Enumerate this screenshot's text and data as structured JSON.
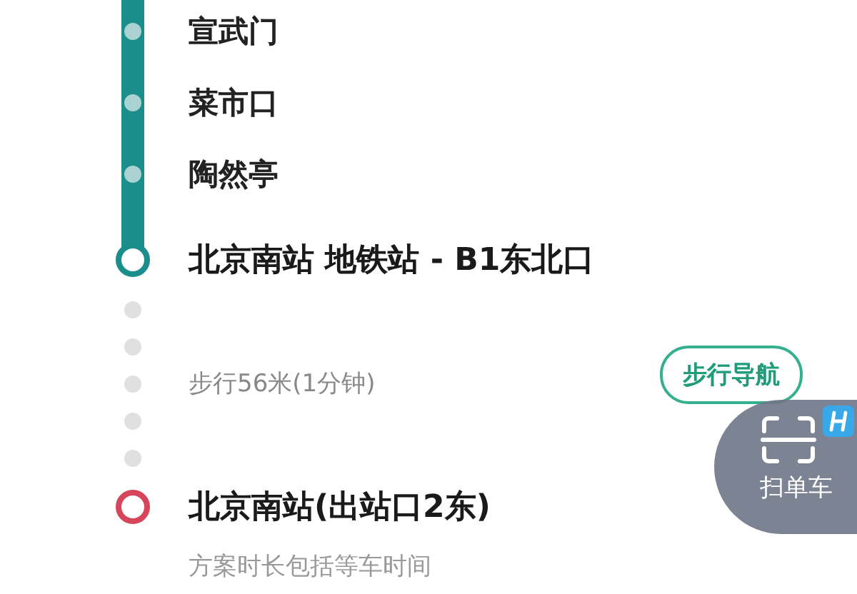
{
  "route": {
    "stops": [
      {
        "name": "宣武门"
      },
      {
        "name": "菜市口"
      },
      {
        "name": "陶然亭"
      }
    ],
    "transfer_station": {
      "name": "北京南站 地铁站 - B1东北口"
    },
    "walk": {
      "text": "步行56米(1分钟)",
      "nav_button": "步行导航"
    },
    "destination": {
      "name": "北京南站(出站口2东)"
    },
    "note": "方案时长包括等车时间"
  },
  "scan_button": {
    "label": "扫单车"
  }
}
